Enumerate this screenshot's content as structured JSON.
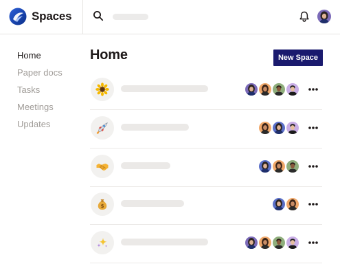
{
  "app": {
    "name": "Spaces"
  },
  "header": {
    "search_placeholder": "",
    "icons": [
      "search-icon",
      "bell-icon",
      "user-avatar"
    ]
  },
  "sidebar": {
    "items": [
      {
        "label": "Home",
        "active": true
      },
      {
        "label": "Paper docs",
        "active": false
      },
      {
        "label": "Tasks",
        "active": false
      },
      {
        "label": "Meetings",
        "active": false
      },
      {
        "label": "Updates",
        "active": false
      }
    ]
  },
  "main": {
    "title": "Home",
    "new_space_label": "New Space",
    "spaces": [
      {
        "icon": "sunflower-icon",
        "members": [
          "purple",
          "orange",
          "green",
          "lilac"
        ]
      },
      {
        "icon": "rocket-icon",
        "members": [
          "orange",
          "blue",
          "lilac"
        ]
      },
      {
        "icon": "handshake-icon",
        "members": [
          "blue",
          "orange",
          "green"
        ]
      },
      {
        "icon": "money-bag-icon",
        "members": [
          "blue",
          "orange"
        ]
      },
      {
        "icon": "sparkles-icon",
        "members": [
          "purple",
          "orange",
          "green",
          "lilac"
        ]
      }
    ]
  },
  "colors": {
    "accent_button": "#1a1a6e",
    "avatar_purple": "#7b6ab8",
    "avatar_orange": "#f0a86a",
    "avatar_green": "#8fae7c",
    "avatar_lilac": "#c9aee6",
    "avatar_blue": "#5a6fc8"
  }
}
